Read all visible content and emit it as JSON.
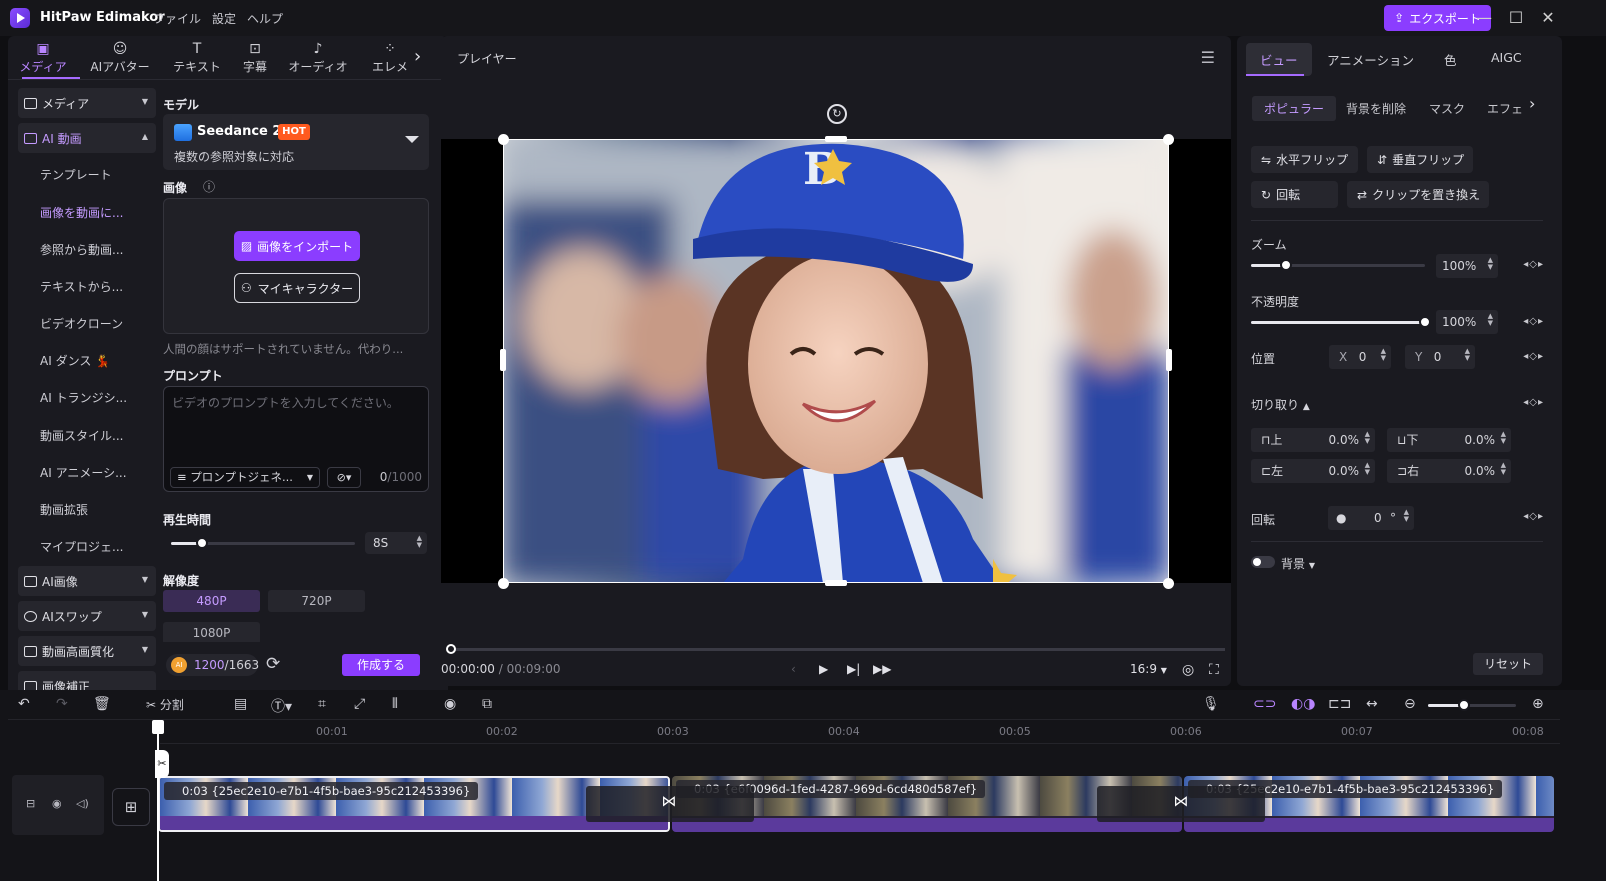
{
  "app": {
    "name": "HitPaw Edimakor",
    "menus": [
      "ファイル",
      "設定",
      "ヘルプ"
    ],
    "export_label": "エクスポート"
  },
  "left_tabs": [
    {
      "label": "メディア",
      "icon": "media-icon"
    },
    {
      "label": "AIアバター",
      "icon": "avatar-icon"
    },
    {
      "label": "テキスト",
      "icon": "text-icon"
    },
    {
      "label": "字幕",
      "icon": "subtitle-icon"
    },
    {
      "label": "オーディオ",
      "icon": "audio-icon"
    },
    {
      "label": "エレメ",
      "icon": "elements-icon"
    }
  ],
  "side_nav": {
    "groups": {
      "media": "メディア",
      "ai_video": "AI 動画",
      "ai_image": "AI画像",
      "ai_swap": "AIスワップ",
      "enhance": "動画高画質化",
      "cut": "画像補正"
    },
    "ai_video_items": [
      "テンプレート",
      "画像を動画に...",
      "参照から動画...",
      "テキストから...",
      "ビデオクローン",
      "AI ダンス 💃",
      "AI トランジシ...",
      "動画スタイル...",
      "AI アニメーシ...",
      "動画拡張",
      "マイプロジェ..."
    ]
  },
  "form": {
    "model_label": "モデル",
    "model_name": "Seedance 2.5",
    "model_badge": "HOT",
    "model_desc": "複数の参照対象に対応",
    "image_label": "画像",
    "info_icon": "ⓘ",
    "import_label": "画像をインポート",
    "mychar_label": "マイキャラクター",
    "face_note": "人間の顔はサポートされていません。代わり...",
    "prompt_label": "プロンプト",
    "prompt_placeholder": "ビデオのプロンプトを入力してください。",
    "prompt_gen_label": "プロンプトジェネ...",
    "prompt_count": "0",
    "prompt_max": "/1000",
    "duration_label": "再生時間",
    "duration_value": "8S",
    "duration_level": 0.17,
    "resolution_label": "解像度",
    "resolutions": [
      "480P",
      "720P",
      "1080P"
    ],
    "credits_used": "1200",
    "credits_total": "/1663",
    "create_label": "作成する"
  },
  "player": {
    "title": "プレイヤー",
    "time_current": "00:00:00",
    "time_total": "/ 00:09:00",
    "aspect": "16:9"
  },
  "right": {
    "tabs": [
      "ビュー",
      "アニメーション",
      "色",
      "AIGC"
    ],
    "subtabs": [
      "ポピュラー",
      "背景を削除",
      "マスク",
      "エフェ"
    ],
    "flip_h": "水平フリップ",
    "flip_v": "垂直フリップ",
    "rotate_btn": "回転",
    "replace_clip": "クリップを置き換え",
    "zoom_label": "ズーム",
    "zoom_value": "100%",
    "zoom_level": 0.2,
    "opacity_label": "不透明度",
    "opacity_value": "100%",
    "opacity_level": 1.0,
    "position_label": "位置",
    "pos_x_label": "X",
    "pos_x": "0",
    "pos_y_label": "Y",
    "pos_y": "0",
    "crop_label": "切り取り",
    "crop_top_label": "上",
    "crop_top": "0.0%",
    "crop_bottom_label": "下",
    "crop_bottom": "0.0%",
    "crop_left_label": "左",
    "crop_left": "0.0%",
    "crop_right_label": "右",
    "crop_right": "0.0%",
    "rotation_label": "回転",
    "rotation_value": "0",
    "rotation_unit": "°",
    "background_label": "背景",
    "reset_label": "リセット"
  },
  "timeline": {
    "split_label": "分割",
    "ticks": [
      "00:01",
      "00:02",
      "00:03",
      "00:04",
      "00:05",
      "00:06",
      "00:07",
      "00:08"
    ],
    "clips": [
      {
        "label": "0:03  {25ec2e10-e7b1-4f5b-bae3-95c212453396}"
      },
      {
        "label": "0:03  {e6f0096d-1fed-4287-969d-6cd480d587ef}"
      },
      {
        "label": "0:03  {25ec2e10-e7b1-4f5b-bae3-95c212453396}"
      }
    ]
  },
  "colors": {
    "accent": "#8b3dff",
    "accent_text": "#c49bff",
    "panel": "#1a1a20",
    "hot": "#ff5a1f"
  }
}
